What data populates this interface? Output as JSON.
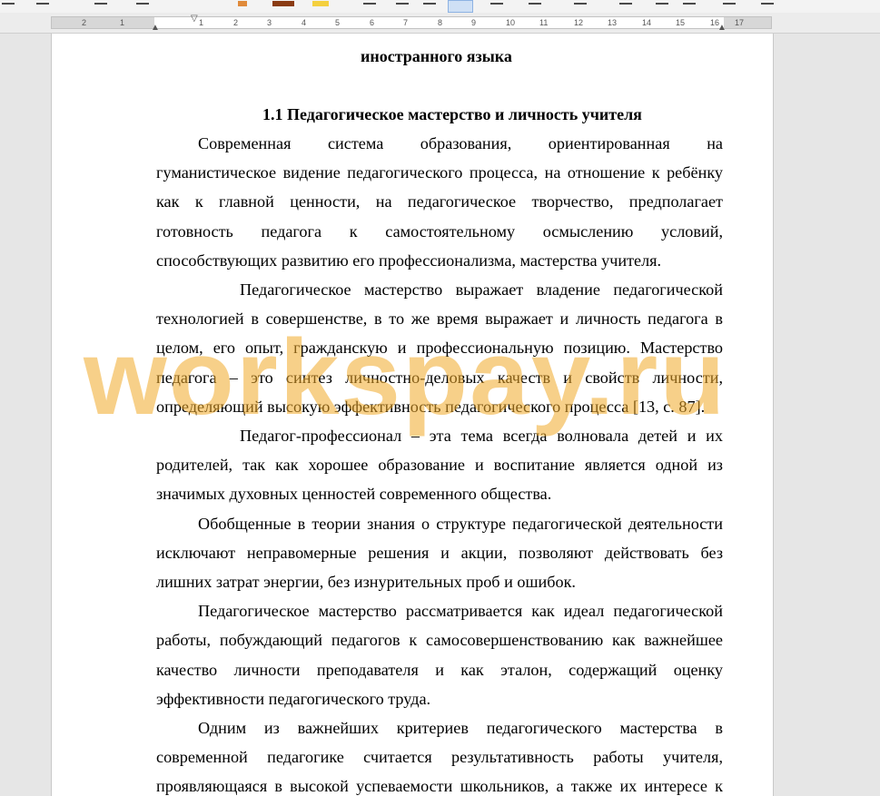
{
  "ruler": {
    "numbers": [
      "2",
      "1",
      "1",
      "2",
      "3",
      "4",
      "5",
      "6",
      "7",
      "8",
      "9",
      "10",
      "11",
      "12",
      "13",
      "14",
      "15",
      "16",
      "17"
    ]
  },
  "document": {
    "heading_top": "иностранного языка",
    "section_heading": "1.1 Педагогическое мастерство и личность учителя",
    "lines": [
      "Современная система образования, ориентированная на",
      "гуманистическое видение педагогического процесса, на отношение к ребёнку",
      "как к главной ценности, на педагогическое творчество, предполагает",
      "готовность педагога к самостоятельному осмыслению условий,",
      "способствующих развитию его профессионализма, мастерства учителя.",
      "Педагогическое мастерство выражает владение педагогической",
      "технологией в совершенстве, в то же время выражает и личность педагога в",
      "целом, его опыт, гражданскую и профессиональную позицию. Мастерство",
      "педагога – это синтез личностно-деловых качеств и свойств личности,",
      "определяющий высокую эффективность педагогического процесса [13, с. 87].",
      "Педагог-профессионал – эта тема всегда волновала детей и их",
      "родителей, так как хорошее образование и воспитание является одной из",
      "значимых духовных ценностей современного общества.",
      "Обобщенные в теории знания о структуре педагогической деятельности",
      "исключают неправомерные решения и акции, позволяют действовать без",
      "лишних затрат энергии, без изнурительных проб и ошибок.",
      "Педагогическое мастерство рассматривается как идеал педагогической",
      "работы, побуждающий педагогов к самосовершенствованию как важнейшее",
      "качество личности преподавателя и как эталон, содержащий оценку",
      "эффективности педагогического труда.",
      "Одним из важнейших критериев педагогического мастерства в",
      "современной педагогике считается результативность работы учителя,",
      "проявляющаяся в высокой успеваемости школьников, а также их интересе к"
    ]
  },
  "watermark": {
    "text": "workspay.ru",
    "color": "#f0aa28"
  }
}
